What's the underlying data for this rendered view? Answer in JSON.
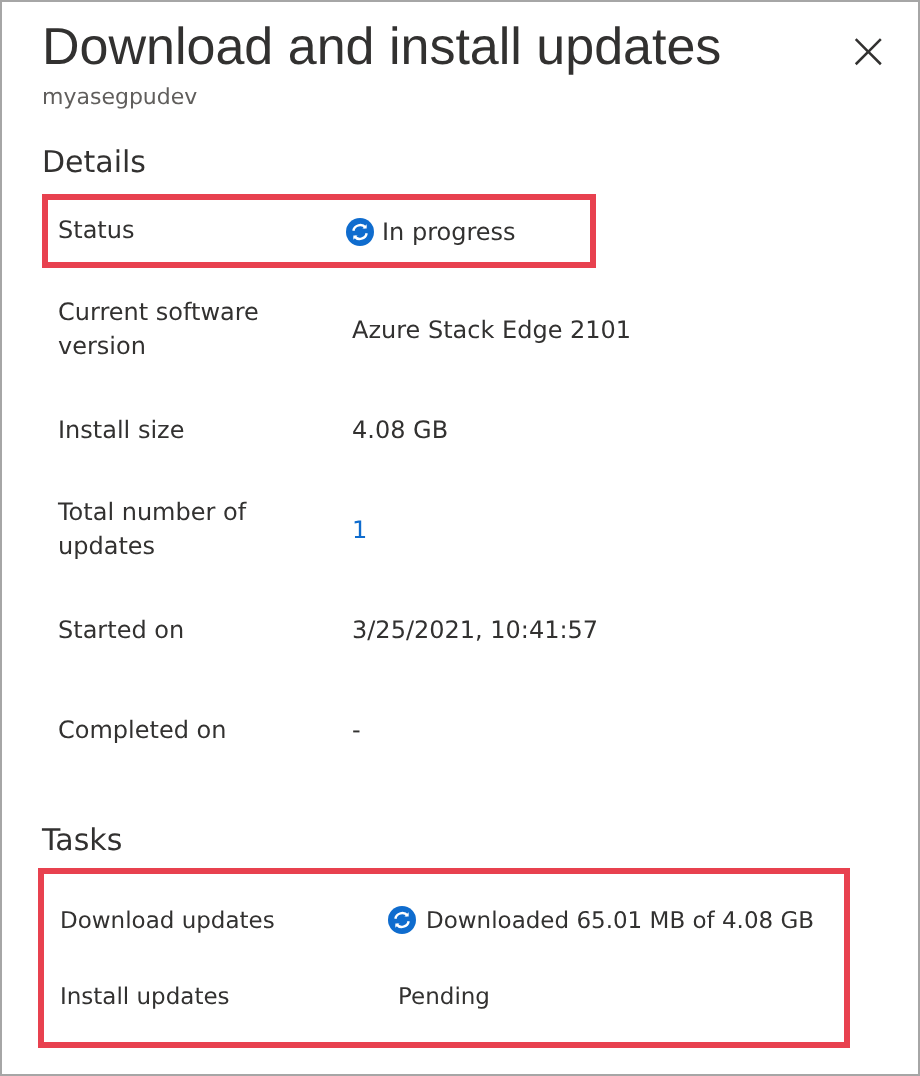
{
  "panel": {
    "title": "Download and install updates",
    "subtitle": "myasegpudev",
    "close_label": "×"
  },
  "details": {
    "heading": "Details",
    "rows": [
      {
        "label": "Status",
        "value": "In progress",
        "kind": "status",
        "highlighted": true
      },
      {
        "label": "Current software version",
        "value": "Azure Stack Edge 2101",
        "kind": "text",
        "highlighted": false
      },
      {
        "label": "Install size",
        "value": "4.08 GB",
        "kind": "text",
        "highlighted": false
      },
      {
        "label": "Total number of updates",
        "value": "1",
        "kind": "link",
        "highlighted": false
      },
      {
        "label": "Started on",
        "value": "3/25/2021, 10:41:57",
        "kind": "text",
        "highlighted": false
      },
      {
        "label": "Completed on",
        "value": "-",
        "kind": "text",
        "highlighted": false
      }
    ]
  },
  "tasks": {
    "heading": "Tasks",
    "highlighted": true,
    "rows": [
      {
        "label": "Download updates",
        "value": "Downloaded 65.01 MB of 4.08 GB",
        "kind": "status"
      },
      {
        "label": "Install updates",
        "value": "Pending",
        "kind": "text"
      }
    ]
  }
}
